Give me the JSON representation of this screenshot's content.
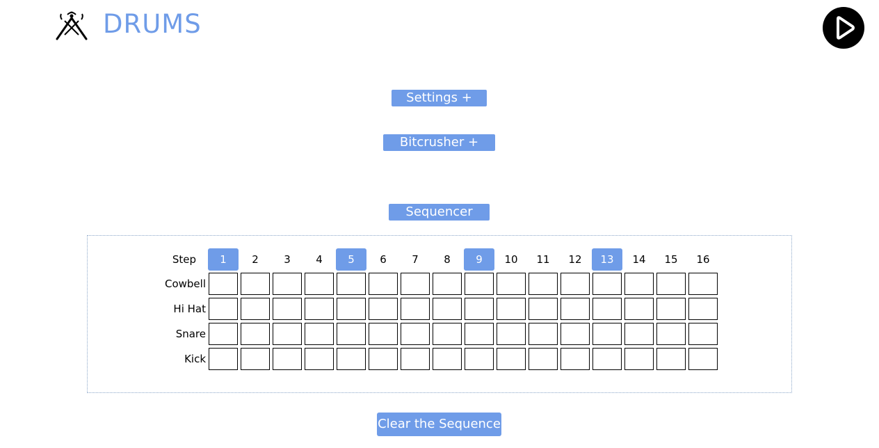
{
  "header": {
    "title": "DRUMS",
    "logo_icon": "drumsticks-icon",
    "play_icon": "play-icon"
  },
  "buttons": {
    "settings": "Settings +",
    "bitcrusher": "Bitcrusher +",
    "sequencer": "Sequencer",
    "clear": "Clear the Sequence"
  },
  "sequencer": {
    "step_label": "Step",
    "steps": [
      "1",
      "2",
      "3",
      "4",
      "5",
      "6",
      "7",
      "8",
      "9",
      "10",
      "11",
      "12",
      "13",
      "14",
      "15",
      "16"
    ],
    "highlighted_steps": [
      1,
      5,
      9,
      13
    ],
    "rows": [
      "Cowbell",
      "Hi Hat",
      "Snare",
      "Kick"
    ]
  },
  "colors": {
    "accent": "#6f9ce8",
    "border": "#000000",
    "frame": "#8aa6c8"
  }
}
